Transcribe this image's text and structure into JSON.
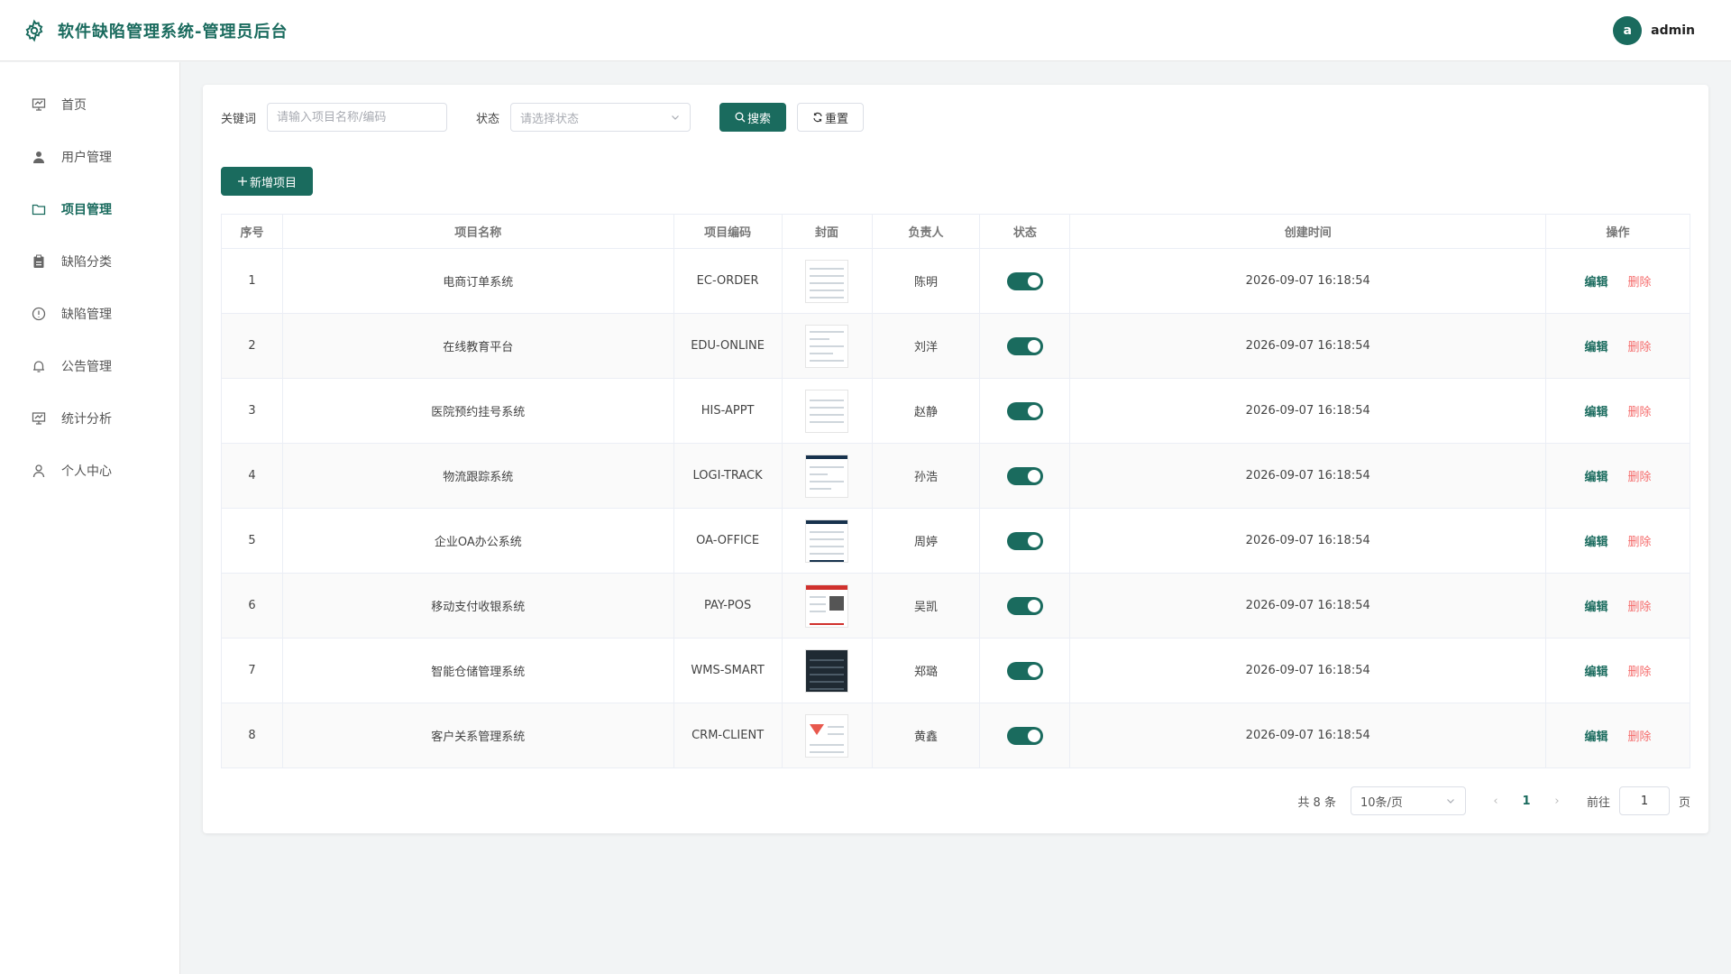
{
  "header": {
    "title": "软件缺陷管理系统-管理员后台",
    "avatar_letter": "a",
    "username": "admin"
  },
  "sidebar": {
    "items": [
      {
        "label": "首页",
        "icon": "chart-board-icon"
      },
      {
        "label": "用户管理",
        "icon": "user-icon"
      },
      {
        "label": "项目管理",
        "icon": "folder-icon",
        "active": true
      },
      {
        "label": "缺陷分类",
        "icon": "clipboard-icon"
      },
      {
        "label": "缺陷管理",
        "icon": "warning-circle-icon"
      },
      {
        "label": "公告管理",
        "icon": "bell-icon"
      },
      {
        "label": "统计分析",
        "icon": "chart-board-icon"
      },
      {
        "label": "个人中心",
        "icon": "person-outline-icon"
      }
    ]
  },
  "filters": {
    "keyword_label": "关键词",
    "keyword_placeholder": "请输入项目名称/编码",
    "keyword_value": "",
    "status_label": "状态",
    "status_placeholder": "请选择状态",
    "search_label": "搜索",
    "reset_label": "重置"
  },
  "toolbar": {
    "add_label": "新增项目"
  },
  "table": {
    "headers": [
      "序号",
      "项目名称",
      "项目编码",
      "封面",
      "负责人",
      "状态",
      "创建时间",
      "操作"
    ],
    "rows": [
      {
        "index": "1",
        "name": "电商订单系统",
        "code": "EC-ORDER",
        "owner": "陈明",
        "status": true,
        "created": "2026-09-07 16:18:54"
      },
      {
        "index": "2",
        "name": "在线教育平台",
        "code": "EDU-ONLINE",
        "owner": "刘洋",
        "status": true,
        "created": "2026-09-07 16:18:54"
      },
      {
        "index": "3",
        "name": "医院预约挂号系统",
        "code": "HIS-APPT",
        "owner": "赵静",
        "status": true,
        "created": "2026-09-07 16:18:54"
      },
      {
        "index": "4",
        "name": "物流跟踪系统",
        "code": "LOGI-TRACK",
        "owner": "孙浩",
        "status": true,
        "created": "2026-09-07 16:18:54"
      },
      {
        "index": "5",
        "name": "企业OA办公系统",
        "code": "OA-OFFICE",
        "owner": "周婷",
        "status": true,
        "created": "2026-09-07 16:18:54"
      },
      {
        "index": "6",
        "name": "移动支付收银系统",
        "code": "PAY-POS",
        "owner": "吴凯",
        "status": true,
        "created": "2026-09-07 16:18:54"
      },
      {
        "index": "7",
        "name": "智能仓储管理系统",
        "code": "WMS-SMART",
        "owner": "郑璐",
        "status": true,
        "created": "2026-09-07 16:18:54"
      },
      {
        "index": "8",
        "name": "客户关系管理系统",
        "code": "CRM-CLIENT",
        "owner": "黄鑫",
        "status": true,
        "created": "2026-09-07 16:18:54"
      }
    ],
    "edit_label": "编辑",
    "delete_label": "删除"
  },
  "pagination": {
    "total_text": "共 8 条",
    "page_size": "10条/页",
    "current_page": "1",
    "goto_label": "前往",
    "goto_value": "1",
    "page_suffix": "页"
  },
  "colors": {
    "primary": "#1a6b5e",
    "danger": "#f56c6c"
  }
}
